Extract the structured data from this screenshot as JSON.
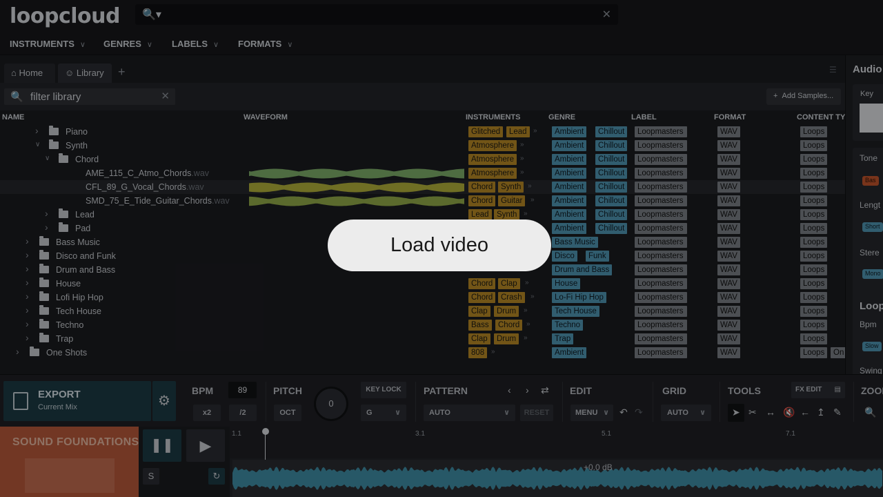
{
  "app": {
    "logo": "loopcloud"
  },
  "search": {
    "placeholder": ""
  },
  "nav": [
    "INSTRUMENTS",
    "GENRES",
    "LABELS",
    "FORMATS"
  ],
  "tabs": [
    {
      "label": "Home"
    },
    {
      "label": "Library"
    }
  ],
  "filter": {
    "value": "filter library"
  },
  "add_samples": "Add Samples...",
  "columns": {
    "name": "NAME",
    "waveform": "WAVEFORM",
    "instruments": "INSTRUMENTS",
    "genre": "GENRE",
    "label": "LABEL",
    "format": "FORMAT",
    "content_type": "CONTENT TYP"
  },
  "rows": [
    {
      "name": "Piano",
      "ext": "",
      "instruments": [
        "Glitched",
        "Lead"
      ],
      "genres": [
        "Ambient",
        "Chillout"
      ],
      "label": "Loopmasters",
      "format": "WAV",
      "ct": [
        "Loops"
      ]
    },
    {
      "name": "Synth",
      "ext": "",
      "instruments": [
        "Atmosphere"
      ],
      "genres": [
        "Ambient",
        "Chillout"
      ],
      "label": "Loopmasters",
      "format": "WAV",
      "ct": [
        "Loops"
      ]
    },
    {
      "name": "Chord",
      "ext": "",
      "instruments": [
        "Atmosphere"
      ],
      "genres": [
        "Ambient",
        "Chillout"
      ],
      "label": "Loopmasters",
      "format": "WAV",
      "ct": [
        "Loops"
      ]
    },
    {
      "name": "AME_115_C_Atmo_Chords",
      "ext": ".wav",
      "instruments": [
        "Atmosphere"
      ],
      "genres": [
        "Ambient",
        "Chillout"
      ],
      "label": "Loopmasters",
      "format": "WAV",
      "ct": [
        "Loops"
      ]
    },
    {
      "name": "CFL_89_G_Vocal_Chords",
      "ext": ".wav",
      "instruments": [
        "Chord",
        "Synth"
      ],
      "genres": [
        "Ambient",
        "Chillout"
      ],
      "label": "Loopmasters",
      "format": "WAV",
      "ct": [
        "Loops"
      ]
    },
    {
      "name": "SMD_75_E_Tide_Guitar_Chords",
      "ext": ".wav",
      "instruments": [
        "Chord",
        "Guitar"
      ],
      "genres": [
        "Ambient",
        "Chillout"
      ],
      "label": "Loopmasters",
      "format": "WAV",
      "ct": [
        "Loops"
      ]
    },
    {
      "name": "Lead",
      "ext": "",
      "instruments": [
        "Lead",
        "Synth"
      ],
      "genres": [
        "Ambient",
        "Chillout"
      ],
      "label": "Loopmasters",
      "format": "WAV",
      "ct": [
        "Loops"
      ]
    },
    {
      "name": "Pad",
      "ext": "",
      "instruments": [],
      "genres": [
        "Ambient",
        "Chillout"
      ],
      "label": "Loopmasters",
      "format": "WAV",
      "ct": [
        "Loops"
      ]
    },
    {
      "name": "Bass Music",
      "ext": "",
      "instruments": [],
      "genres": [
        "Bass Music"
      ],
      "label": "Loopmasters",
      "format": "WAV",
      "ct": [
        "Loops"
      ]
    },
    {
      "name": "Disco and Funk",
      "ext": "",
      "instruments": [],
      "genres": [
        "Disco",
        "Funk"
      ],
      "label": "Loopmasters",
      "format": "WAV",
      "ct": [
        "Loops"
      ]
    },
    {
      "name": "Drum and Bass",
      "ext": "",
      "instruments": [],
      "genres": [
        "Drum and Bass"
      ],
      "label": "Loopmasters",
      "format": "WAV",
      "ct": [
        "Loops"
      ]
    },
    {
      "name": "House",
      "ext": "",
      "instruments": [
        "Chord",
        "Clap"
      ],
      "genres": [
        "House"
      ],
      "label": "Loopmasters",
      "format": "WAV",
      "ct": [
        "Loops"
      ]
    },
    {
      "name": "Lofi Hip Hop",
      "ext": "",
      "instruments": [
        "Chord",
        "Crash"
      ],
      "genres": [
        "Lo-Fi Hip Hop"
      ],
      "label": "Loopmasters",
      "format": "WAV",
      "ct": [
        "Loops"
      ]
    },
    {
      "name": "Tech House",
      "ext": "",
      "instruments": [
        "Clap",
        "Drum"
      ],
      "genres": [
        "Tech House"
      ],
      "label": "Loopmasters",
      "format": "WAV",
      "ct": [
        "Loops"
      ]
    },
    {
      "name": "Techno",
      "ext": "",
      "instruments": [
        "Bass",
        "Chord"
      ],
      "genres": [
        "Techno"
      ],
      "label": "Loopmasters",
      "format": "WAV",
      "ct": [
        "Loops"
      ]
    },
    {
      "name": "Trap",
      "ext": "",
      "instruments": [
        "Clap",
        "Drum"
      ],
      "genres": [
        "Trap"
      ],
      "label": "Loopmasters",
      "format": "WAV",
      "ct": [
        "Loops"
      ]
    },
    {
      "name": "One Shots",
      "ext": "",
      "instruments": [
        "808"
      ],
      "genres": [
        "Ambient"
      ],
      "label": "Loopmasters",
      "format": "WAV",
      "ct": [
        "Loops",
        "On"
      ]
    }
  ],
  "right_panel": {
    "title": "Audio",
    "key": "Key",
    "tone": "Tone",
    "tone_pill": "Bas",
    "length": "Lengt",
    "length_pill": "Short",
    "stereo": "Stere",
    "stereo_pill": "Mono",
    "loop_title": "Loop",
    "bpm": "Bpm",
    "bpm_pill": "Slow",
    "swing": "Swing"
  },
  "controls": {
    "export_title": "EXPORT",
    "export_sub": "Current Mix",
    "bpm_label": "BPM",
    "bpm_value": "89",
    "x2": "x2",
    "half": "/2",
    "pitch_label": "PITCH",
    "oct": "OCT",
    "knob_value": "0",
    "key_lock": "KEY LOCK",
    "key_value": "G",
    "pattern_label": "PATTERN",
    "pattern_value": "AUTO",
    "reset": "RESET",
    "edit_label": "EDIT",
    "menu": "MENU",
    "grid_label": "GRID",
    "grid_value": "AUTO",
    "tools_label": "TOOLS",
    "fx_edit": "FX EDIT",
    "zoom_label": "ZOOM"
  },
  "player": {
    "cover_title": "SOUND FOUNDATIONS",
    "solo": "S",
    "ruler": [
      "1.1",
      "3.1",
      "5.1",
      "7.1"
    ],
    "db": "+0.0 dB"
  },
  "overlay": {
    "button": "Load video"
  },
  "colors": {
    "instrument_tag": "#b98a26",
    "genre_tag": "#4f97b3",
    "export_bg": "#1c3a45"
  }
}
